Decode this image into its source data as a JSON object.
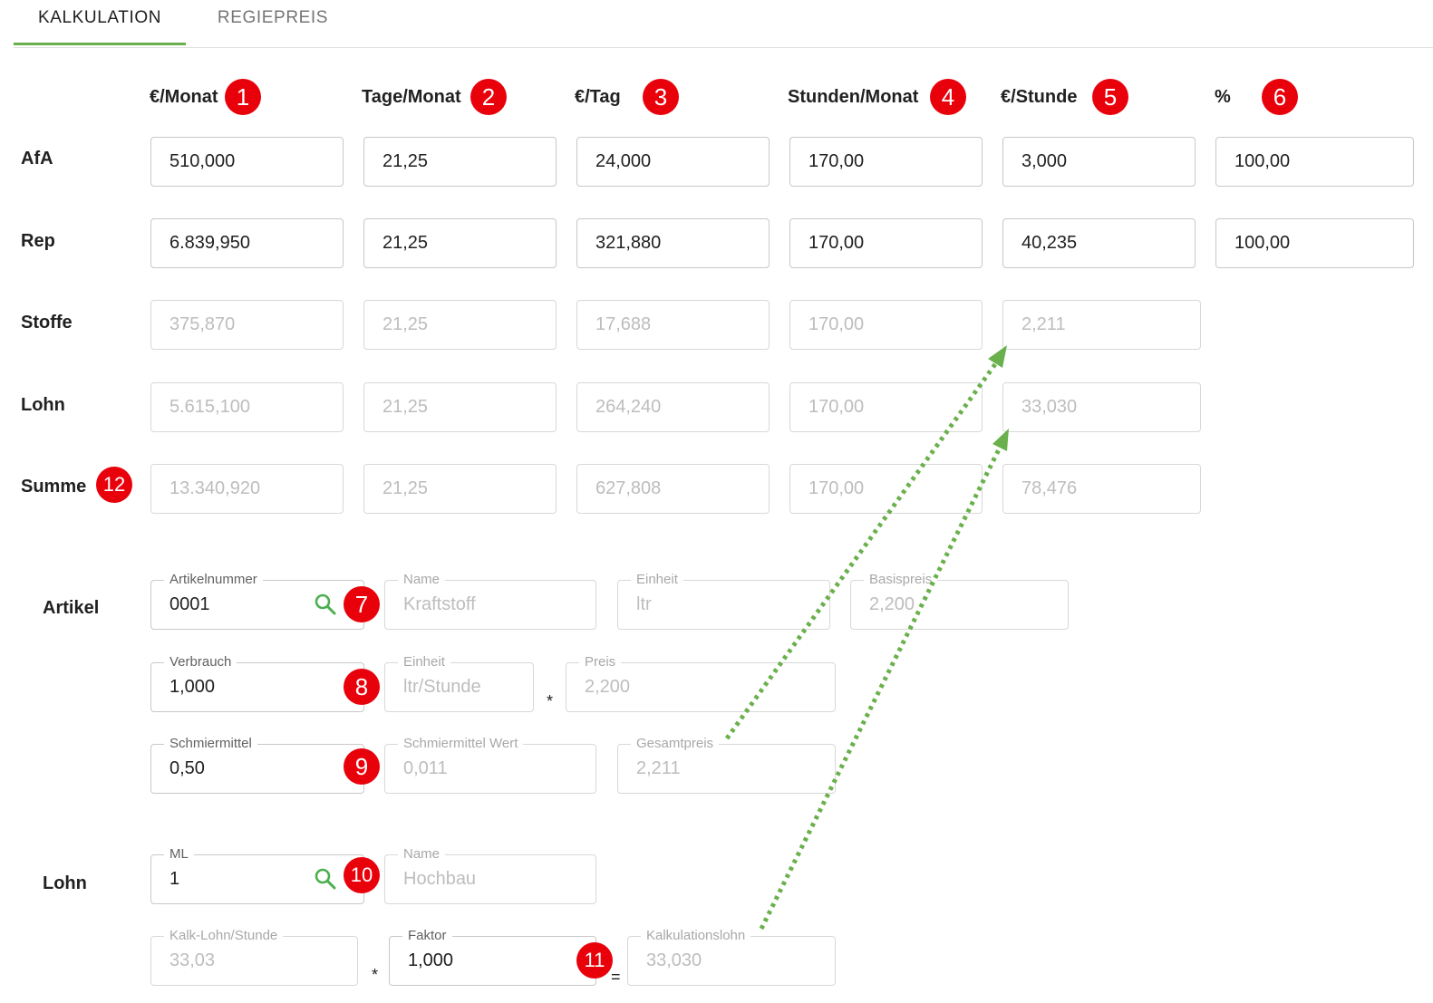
{
  "tabs": [
    {
      "label": "KALKULATION",
      "active": true
    },
    {
      "label": "REGIEPREIS",
      "active": false
    }
  ],
  "columns": [
    {
      "label": "€/Monat",
      "badge": "1"
    },
    {
      "label": "Tage/Monat",
      "badge": "2"
    },
    {
      "label": "€/Tag",
      "badge": "3"
    },
    {
      "label": "Stunden/Monat",
      "badge": "4"
    },
    {
      "label": "€/Stunde",
      "badge": "5"
    },
    {
      "label": "%",
      "badge": "6"
    }
  ],
  "rows": [
    {
      "label": "AfA",
      "values": [
        "510,000",
        "21,25",
        "24,000",
        "170,00",
        "3,000",
        "100,00"
      ]
    },
    {
      "label": "Rep",
      "values": [
        "6.839,950",
        "21,25",
        "321,880",
        "170,00",
        "40,235",
        "100,00"
      ]
    },
    {
      "label": "Stoffe",
      "values": [
        "375,870",
        "21,25",
        "17,688",
        "170,00",
        "2,211"
      ]
    },
    {
      "label": "Lohn",
      "values": [
        "5.615,100",
        "21,25",
        "264,240",
        "170,00",
        "33,030"
      ]
    },
    {
      "label": "Summe",
      "badge": "12",
      "values": [
        "13.340,920",
        "21,25",
        "627,808",
        "170,00",
        "78,476"
      ]
    }
  ],
  "artikel": {
    "section_label": "Artikel",
    "artikelnummer": {
      "label": "Artikelnummer",
      "value": "0001",
      "badge": "7"
    },
    "name": {
      "label": "Name",
      "value": "Kraftstoff"
    },
    "einheit": {
      "label": "Einheit",
      "value": "ltr"
    },
    "basispreis": {
      "label": "Basispreis",
      "value": "2,200"
    },
    "verbrauch": {
      "label": "Verbrauch",
      "value": "1,000",
      "badge": "8"
    },
    "verbrauch_einheit": {
      "label": "Einheit",
      "value": "ltr/Stunde"
    },
    "multiply_sign": "*",
    "preis": {
      "label": "Preis",
      "value": "2,200"
    },
    "schmiermittel": {
      "label": "Schmiermittel",
      "value": "0,50",
      "badge": "9"
    },
    "schmiermittel_wert": {
      "label": "Schmiermittel Wert",
      "value": "0,011"
    },
    "gesamtpreis": {
      "label": "Gesamtpreis",
      "value": "2,211"
    }
  },
  "lohn": {
    "section_label": "Lohn",
    "ml": {
      "label": "ML",
      "value": "1",
      "badge": "10"
    },
    "name": {
      "label": "Name",
      "value": "Hochbau"
    },
    "kalk_lohn": {
      "label": "Kalk-Lohn/Stunde",
      "value": "33,03"
    },
    "multiply_sign": "*",
    "faktor": {
      "label": "Faktor",
      "value": "1,000",
      "badge": "11"
    },
    "equals_sign": "=",
    "kalkulationslohn": {
      "label": "Kalkulationslohn",
      "value": "33,030"
    }
  },
  "colors": {
    "accent_green": "#6ab04c",
    "badge_red": "#e8000b",
    "arrow_green": "#6ab04c"
  }
}
